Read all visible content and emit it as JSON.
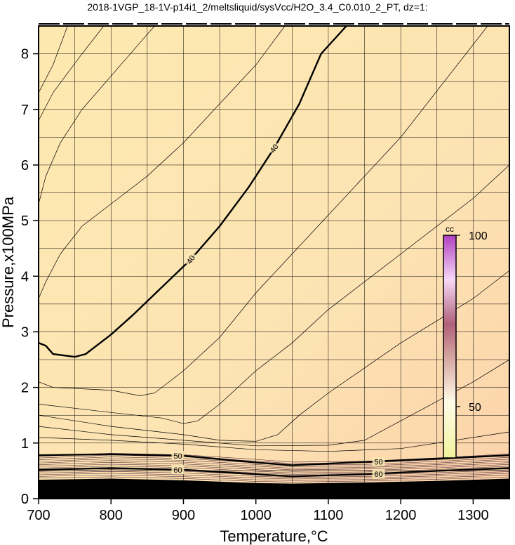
{
  "chart_data": {
    "type": "contour",
    "title": "2018-1VGP_18-1V-p14i1_2/meltsliquid/sysVcc/H2O_3.4_C0.010_2_PT, dz=1:",
    "xlabel": "Temperature,°C",
    "ylabel": "Pressure,x100MPa",
    "xlim": [
      700,
      1350
    ],
    "ylim": [
      0,
      8.5
    ],
    "xticks": [
      700,
      800,
      900,
      1000,
      1100,
      1200,
      1300
    ],
    "yticks": [
      0,
      1,
      2,
      3,
      4,
      5,
      6,
      7,
      8
    ],
    "grid": true,
    "colormap": {
      "low": "#f4f0a0",
      "mid": "#fde7b4",
      "high": "#b040c0"
    },
    "colorbar": {
      "label": "cc",
      "ticks": [
        50,
        100
      ],
      "range": [
        35,
        100
      ]
    },
    "contours": [
      {
        "level": 40,
        "bold": true,
        "labels": [
          "40",
          "40"
        ],
        "points": [
          [
            700,
            2.8
          ],
          [
            710,
            2.75
          ],
          [
            720,
            2.6
          ],
          [
            750,
            2.55
          ],
          [
            765,
            2.6
          ],
          [
            775,
            2.7
          ],
          [
            800,
            2.95
          ],
          [
            830,
            3.3
          ],
          [
            870,
            3.8
          ],
          [
            910,
            4.3
          ],
          [
            950,
            4.9
          ],
          [
            990,
            5.6
          ],
          [
            1025,
            6.3
          ],
          [
            1060,
            7.1
          ],
          [
            1090,
            8.0
          ],
          [
            1125,
            8.5
          ]
        ]
      },
      {
        "level": 50,
        "bold": true,
        "labels": [
          "50",
          "50"
        ],
        "points": [
          [
            700,
            0.78
          ],
          [
            800,
            0.8
          ],
          [
            900,
            0.77
          ],
          [
            1000,
            0.65
          ],
          [
            1050,
            0.6
          ],
          [
            1150,
            0.66
          ],
          [
            1250,
            0.72
          ],
          [
            1350,
            0.78
          ]
        ]
      },
      {
        "level": 60,
        "bold": true,
        "labels": [
          "60",
          "60"
        ],
        "points": [
          [
            700,
            0.52
          ],
          [
            800,
            0.55
          ],
          [
            900,
            0.52
          ],
          [
            1000,
            0.44
          ],
          [
            1050,
            0.4
          ],
          [
            1150,
            0.44
          ],
          [
            1250,
            0.5
          ],
          [
            1350,
            0.55
          ]
        ]
      },
      {
        "level": null,
        "bold": false,
        "points": [
          [
            700,
            2.1
          ],
          [
            720,
            2.0
          ],
          [
            800,
            1.95
          ],
          [
            840,
            1.85
          ],
          [
            860,
            1.9
          ],
          [
            900,
            2.3
          ],
          [
            950,
            2.9
          ],
          [
            1000,
            3.7
          ],
          [
            1050,
            4.4
          ],
          [
            1100,
            5.1
          ],
          [
            1200,
            6.5
          ],
          [
            1320,
            8.5
          ]
        ]
      },
      {
        "level": null,
        "bold": false,
        "points": [
          [
            700,
            1.7
          ],
          [
            800,
            1.55
          ],
          [
            870,
            1.45
          ],
          [
            900,
            1.35
          ],
          [
            920,
            1.4
          ],
          [
            950,
            1.7
          ],
          [
            1000,
            2.3
          ],
          [
            1050,
            2.8
          ],
          [
            1100,
            3.4
          ],
          [
            1200,
            4.4
          ],
          [
            1300,
            5.4
          ],
          [
            1350,
            6.0
          ]
        ]
      },
      {
        "level": null,
        "bold": false,
        "points": [
          [
            700,
            1.5
          ],
          [
            800,
            1.3
          ],
          [
            900,
            1.15
          ],
          [
            950,
            1.05
          ],
          [
            1000,
            1.03
          ],
          [
            1030,
            1.15
          ],
          [
            1060,
            1.5
          ],
          [
            1100,
            1.9
          ],
          [
            1200,
            2.8
          ],
          [
            1300,
            3.6
          ],
          [
            1350,
            4.1
          ]
        ]
      },
      {
        "level": null,
        "bold": false,
        "points": [
          [
            700,
            1.3
          ],
          [
            800,
            1.15
          ],
          [
            900,
            1.05
          ],
          [
            1000,
            0.95
          ],
          [
            1100,
            0.96
          ],
          [
            1150,
            1.05
          ],
          [
            1200,
            1.4
          ],
          [
            1300,
            2.1
          ],
          [
            1350,
            2.5
          ]
        ]
      },
      {
        "level": null,
        "bold": false,
        "points": [
          [
            700,
            1.1
          ],
          [
            800,
            1.05
          ],
          [
            900,
            0.98
          ],
          [
            1000,
            0.88
          ],
          [
            1100,
            0.85
          ],
          [
            1200,
            0.9
          ],
          [
            1300,
            1.1
          ],
          [
            1350,
            1.2
          ]
        ]
      },
      {
        "level": null,
        "bold": false,
        "points": [
          [
            700,
            3.6
          ],
          [
            710,
            3.9
          ],
          [
            730,
            4.4
          ],
          [
            760,
            4.9
          ],
          [
            800,
            5.3
          ],
          [
            850,
            5.8
          ],
          [
            900,
            6.4
          ],
          [
            950,
            7.1
          ],
          [
            1000,
            7.8
          ],
          [
            1040,
            8.5
          ]
        ]
      },
      {
        "level": null,
        "bold": false,
        "points": [
          [
            700,
            5.3
          ],
          [
            710,
            5.8
          ],
          [
            730,
            6.4
          ],
          [
            760,
            7.0
          ],
          [
            800,
            7.6
          ],
          [
            840,
            8.2
          ],
          [
            860,
            8.5
          ]
        ]
      },
      {
        "level": null,
        "bold": false,
        "points": [
          [
            700,
            7.3
          ],
          [
            720,
            7.8
          ],
          [
            740,
            8.5
          ]
        ]
      },
      {
        "level": null,
        "bold": false,
        "points": [
          [
            700,
            6.8
          ],
          [
            720,
            7.3
          ],
          [
            760,
            8.0
          ],
          [
            790,
            8.5
          ]
        ]
      }
    ]
  }
}
